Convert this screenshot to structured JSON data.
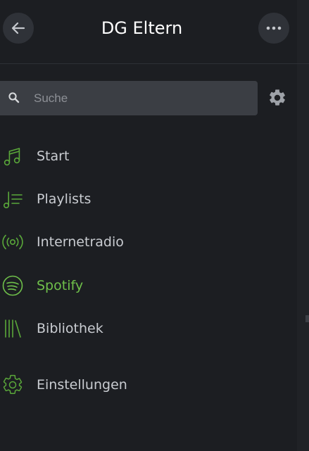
{
  "header": {
    "title": "DG Eltern",
    "back_icon": "arrow-left-icon",
    "more_icon": "more-horizontal-icon"
  },
  "search": {
    "placeholder": "Suche",
    "value": "",
    "icon": "search-icon"
  },
  "settings_icon": "gear-icon",
  "nav": {
    "items": [
      {
        "label": "Start",
        "icon": "music-note-icon",
        "active": false
      },
      {
        "label": "Playlists",
        "icon": "playlist-icon",
        "active": false
      },
      {
        "label": "Internetradio",
        "icon": "radio-broadcast-icon",
        "active": false
      },
      {
        "label": "Spotify",
        "icon": "spotify-icon",
        "active": true
      },
      {
        "label": "Bibliothek",
        "icon": "library-icon",
        "active": false
      },
      {
        "label": "Einstellungen",
        "icon": "settings-outline-icon",
        "active": false
      }
    ]
  },
  "colors": {
    "background": "#1c1e22",
    "accent_green": "#6fc04a",
    "icon_green": "#5aa83a",
    "text": "#c9ccd1",
    "button_bg": "#2f3238"
  }
}
